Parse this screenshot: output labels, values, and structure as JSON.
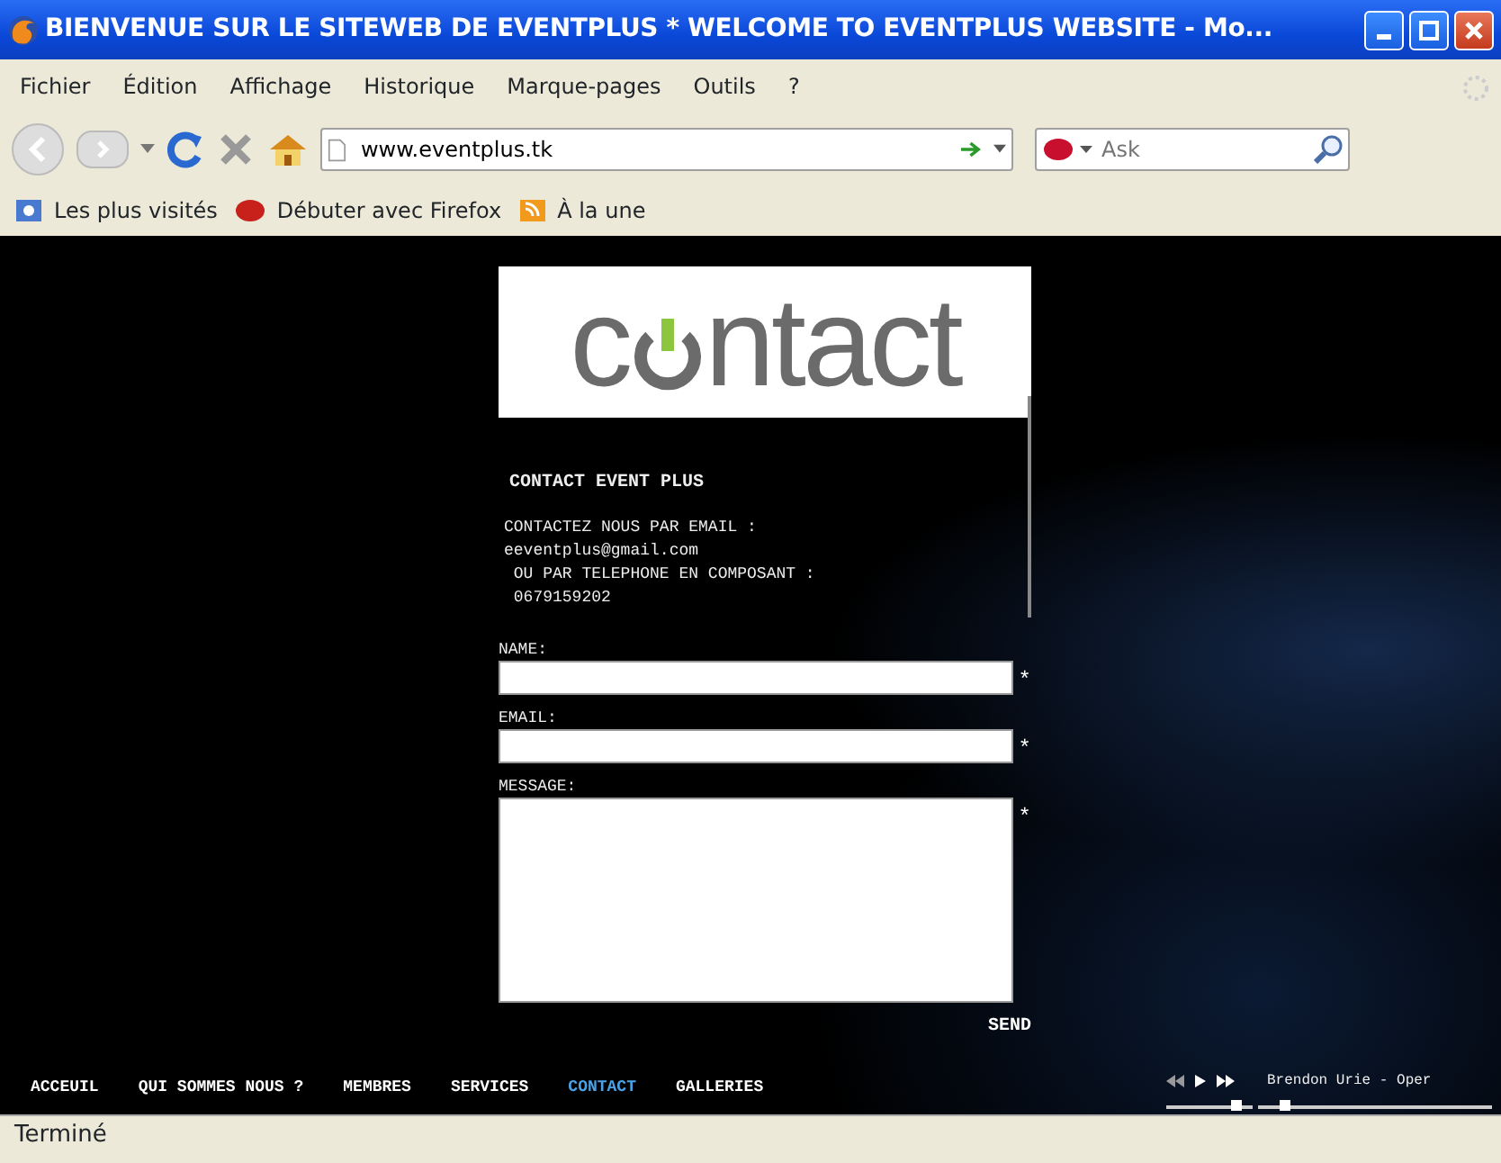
{
  "window": {
    "title": "BIENVENUE SUR LE SITEWEB DE EVENTPLUS * WELCOME TO EVENTPLUS WEBSITE - Mo..."
  },
  "menu": [
    "Fichier",
    "Édition",
    "Affichage",
    "Historique",
    "Marque-pages",
    "Outils",
    "?"
  ],
  "toolbar": {
    "url": "www.eventplus.tk",
    "search_placeholder": "Ask"
  },
  "bookmarks": [
    "Les plus visités",
    "Débuter avec Firefox",
    "À la une"
  ],
  "page": {
    "logo": {
      "before": "c",
      "after": "ntact"
    },
    "heading": "CONTACT EVENT PLUS",
    "info_lines": [
      "CONTACTEZ NOUS PAR EMAIL :",
      "eeventplus@gmail.com",
      " OU PAR TELEPHONE EN COMPOSANT :",
      " 0679159202"
    ],
    "fields": [
      {
        "label": "NAME:",
        "kind": "text",
        "required_mark": "*"
      },
      {
        "label": "EMAIL:",
        "kind": "text",
        "required_mark": "*"
      },
      {
        "label": "MESSAGE:",
        "kind": "textarea",
        "required_mark": "*"
      }
    ],
    "send": "SEND",
    "nav": [
      {
        "label": "ACCEUIL",
        "selected": false
      },
      {
        "label": "QUI SOMMES NOUS ?",
        "selected": false
      },
      {
        "label": "MEMBRES",
        "selected": false
      },
      {
        "label": "SERVICES",
        "selected": false
      },
      {
        "label": "CONTACT",
        "selected": true
      },
      {
        "label": "GALLERIES",
        "selected": false
      }
    ],
    "player": {
      "track": "Brendon Urie - Oper",
      "volume": {
        "level": 0.85
      },
      "progress": {
        "level": 0.1
      }
    }
  },
  "status_bar": "Terminé"
}
